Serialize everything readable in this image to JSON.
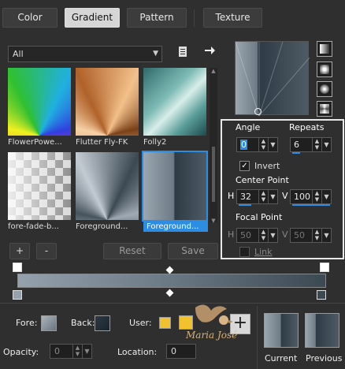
{
  "tabs": [
    {
      "label": "Color",
      "active": false
    },
    {
      "label": "Gradient",
      "active": true
    },
    {
      "label": "Pattern",
      "active": false
    },
    {
      "label": "Texture",
      "active": false
    }
  ],
  "filter": {
    "value": "All"
  },
  "gradients": [
    {
      "name": "FlowerPowe...",
      "selected": false
    },
    {
      "name": "Flutter Fly-FK",
      "selected": false
    },
    {
      "name": "Folly2",
      "selected": false
    },
    {
      "name": "fore-fade-b...",
      "selected": false
    },
    {
      "name": "Foreground...",
      "selected": false
    },
    {
      "name": "Foreground...",
      "selected": true
    }
  ],
  "list_buttons": {
    "add": "+",
    "remove": "-",
    "reset": "Reset",
    "save": "Save"
  },
  "angle_panel": {
    "angle_label": "Angle",
    "angle_value": "0",
    "repeats_label": "Repeats",
    "repeats_value": "6",
    "invert_label": "Invert",
    "invert_checked": true,
    "center_point_label": "Center Point",
    "center_h_label": "H",
    "center_h_value": "32",
    "center_v_label": "V",
    "center_v_value": "100",
    "focal_point_label": "Focal Point",
    "focal_h_label": "H",
    "focal_h_value": "50",
    "focal_v_label": "V",
    "focal_v_value": "50",
    "link_label": "Link",
    "link_checked": false
  },
  "bottom": {
    "fore_label": "Fore:",
    "back_label": "Back:",
    "user_label": "User:",
    "opacity_label": "Opacity:",
    "opacity_value": "0",
    "location_label": "Location:",
    "location_value": "0",
    "current_label": "Current",
    "previous_label": "Previous",
    "watermark": "Maria José"
  },
  "colors": {
    "accent": "#2d8de3",
    "user_color": "#f2c12e",
    "gradient_start": "#95a1ac",
    "gradient_end": "#3c4953"
  },
  "icons": [
    "open-file-icon",
    "arrow-right-icon",
    "chevron-down-icon",
    "plus-icon",
    "linear-gradient-icon",
    "radial-gradient-icon",
    "rectangular-gradient-icon",
    "sunburst-gradient-icon"
  ]
}
